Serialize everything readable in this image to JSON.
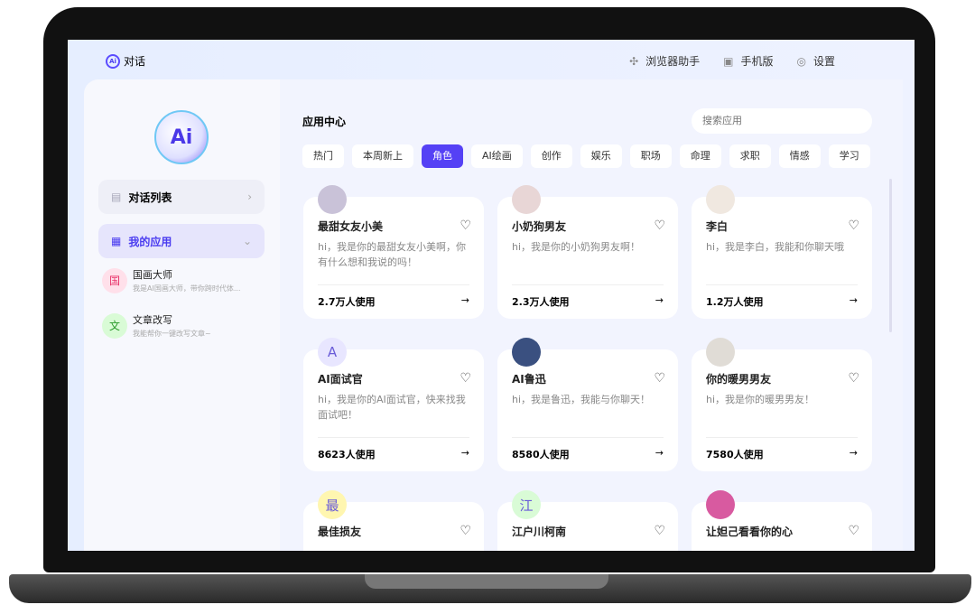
{
  "header": {
    "logo_label": "对话",
    "items": [
      {
        "icon": "puzzle-icon",
        "label": "浏览器助手"
      },
      {
        "icon": "phone-icon",
        "label": "手机版"
      },
      {
        "icon": "gear-icon",
        "label": "设置"
      }
    ]
  },
  "sidebar": {
    "logo": "Ai",
    "chat_list": "对话列表",
    "my_apps": "我的应用",
    "apps": [
      {
        "initial": "国",
        "name": "国画大师",
        "desc": "我是AI国画大师，带你跨时代体...",
        "bg": "#ffe0ea",
        "fg": "#e8336a"
      },
      {
        "initial": "文",
        "name": "文章改写",
        "desc": "我能帮你一键改写文章~",
        "bg": "#d9fbd6",
        "fg": "#2a9a2a"
      }
    ]
  },
  "main": {
    "title": "应用中心",
    "search_placeholder": "搜索应用",
    "tabs": [
      "热门",
      "本周新上",
      "角色",
      "AI绘画",
      "创作",
      "娱乐",
      "职场",
      "命理",
      "求职",
      "情感",
      "学习"
    ],
    "active_tab": "角色",
    "cards": [
      {
        "name": "最甜女友小美",
        "desc": "hi，我是你的最甜女友小美啊，你有什么想和我说的吗！",
        "usage": "2.7万人使用",
        "avatar": "",
        "avbg": "#c9c2d8"
      },
      {
        "name": "小奶狗男友",
        "desc": "hi，我是你的小奶狗男友啊！",
        "usage": "2.3万人使用",
        "avatar": "",
        "avbg": "#e8d6d6"
      },
      {
        "name": "李白",
        "desc": "hi，我是李白，我能和你聊天哦",
        "usage": "1.2万人使用",
        "avatar": "",
        "avbg": "#f0e8e0"
      },
      {
        "name": "AI面试官",
        "desc": "hi，我是你的AI面试官，快来找我面试吧！",
        "usage": "8623人使用",
        "avatar": "A",
        "avbg": "#e8e6ff"
      },
      {
        "name": "AI鲁迅",
        "desc": "hi，我是鲁迅，我能与你聊天！",
        "usage": "8580人使用",
        "avatar": "",
        "avbg": "#3a5080"
      },
      {
        "name": "你的暖男男友",
        "desc": "hi，我是你的暖男男友！",
        "usage": "7580人使用",
        "avatar": "",
        "avbg": "#e0dcd6"
      },
      {
        "name": "最佳损友",
        "desc": "",
        "usage": "",
        "avatar": "最",
        "avbg": "#fff6b0"
      },
      {
        "name": "江户川柯南",
        "desc": "",
        "usage": "",
        "avatar": "江",
        "avbg": "#d9fbd6"
      },
      {
        "name": "让妲己看看你的心",
        "desc": "",
        "usage": "",
        "avatar": "",
        "avbg": "#d85aa0"
      }
    ]
  },
  "colors": {
    "accent": "#5541f5"
  }
}
